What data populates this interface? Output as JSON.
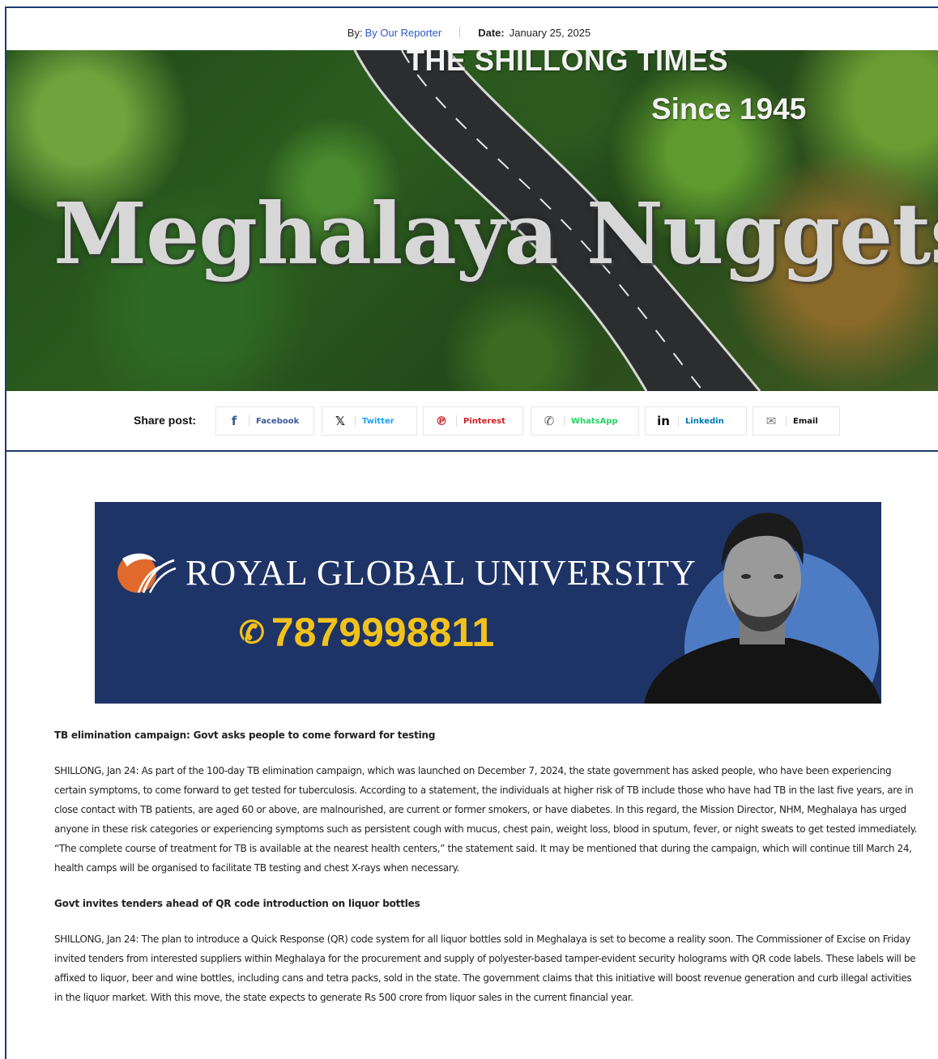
{
  "meta": {
    "by_label": "By:",
    "author": "By Our Reporter",
    "date_label": "Date:",
    "date_value": "January 25, 2025"
  },
  "hero": {
    "brand": "THE SHILLONG TIMES",
    "since": "Since 1945",
    "headline": "Meghalaya Nuggets"
  },
  "share": {
    "label": "Share post:",
    "buttons": [
      {
        "label": "Facebook",
        "icon": "facebook-icon",
        "color": "#3b5998"
      },
      {
        "label": "Twitter",
        "icon": "x-icon",
        "color": "#1da1f2"
      },
      {
        "label": "Pinterest",
        "icon": "pinterest-icon",
        "color": "#cb2027"
      },
      {
        "label": "WhatsApp",
        "icon": "whatsapp-icon",
        "color": "#25d366"
      },
      {
        "label": "Linkedin",
        "icon": "linkedin-icon",
        "color": "#0077b5"
      },
      {
        "label": "Email",
        "icon": "mail-icon",
        "color": "#111111"
      }
    ]
  },
  "ad": {
    "university": "ROYAL GLOBAL UNIVERSITY",
    "phone": "7879998811",
    "bg_color": "#1e3466",
    "phone_color": "#f2c21b"
  },
  "articles": [
    {
      "title": "TB elimination campaign: Govt asks people to come forward for testing",
      "body": "SHILLONG, Jan 24: As part of the 100-day TB elimination campaign, which was launched on December 7, 2024, the state government has asked people, who have been experiencing certain symptoms, to come forward to get tested for tuberculosis. According to a statement, the individuals at higher risk of TB include those who have had TB in the last five years, are in close contact with TB patients, are aged 60 or above, are malnourished, are current or former smokers, or have diabetes. In this regard, the Mission Director, NHM, Meghalaya has urged anyone in these risk categories or experiencing symptoms such as persistent cough with mucus, chest pain, weight loss, blood in sputum, fever, or night sweats to get tested immediately. “The complete course of treatment for TB is available at the nearest health centers,” the statement said. It may be mentioned that during the campaign, which will continue till March 24, health camps will be organised to facilitate TB testing and chest X-rays when necessary."
    },
    {
      "title": "Govt invites tenders ahead of QR code introduction on liquor bottles",
      "body": "SHILLONG, Jan 24: The plan to introduce a Quick Response (QR) code system for all liquor bottles sold in Meghalaya is set to become a reality soon. The Commissioner of Excise on Friday invited tenders from interested suppliers within Meghalaya for the procurement and supply of polyester-based tamper-evident security holograms with QR code labels. These labels will be affixed to liquor, beer and wine bottles, including cans and tetra packs, sold in the state. The government claims that this initiative will boost revenue generation and curb illegal activities in the liquor market. With this move, the state expects to generate Rs 500 crore from liquor sales in the current financial year."
    }
  ]
}
